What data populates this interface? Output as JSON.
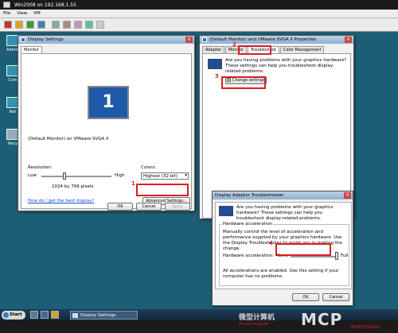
{
  "vm": {
    "title": "Win2008 on 192.168.1.55",
    "menu": [
      "File",
      "View",
      "VM"
    ]
  },
  "desktop": {
    "icons": [
      "Admin",
      "Com",
      "Net",
      "Recy"
    ]
  },
  "display_settings": {
    "title": "Display Settings",
    "tab": "Monitor",
    "monitor_number": "1",
    "monitor_name": "(Default Monitor) on VMware SVGA II",
    "resolution_label": "Resolution:",
    "low": "Low",
    "high": "High",
    "resolution_value": "1024 by 768 pixels",
    "colors_label": "Colors:",
    "colors_value": "Highest (32 bit)",
    "help_link": "How do I get the best display?",
    "advanced_button": "Advanced Settings...",
    "ok": "OK",
    "cancel": "Cancel",
    "apply": "Apply"
  },
  "properties": {
    "title": "(Default Monitor) and VMware SVGA II Properties",
    "tabs": [
      "Adapter",
      "Monitor",
      "Troubleshoot",
      "Color Management"
    ],
    "text": "Are you having problems with your graphics hardware? These settings can help you troubleshoot display-related problems.",
    "change_button": "Change settings"
  },
  "troubleshooter": {
    "title": "Display Adapter Troubleshooter",
    "intro": "Are you having problems with your graphics hardware? These settings can help you troubleshoot display-related problems.",
    "group": "Hardware acceleration",
    "desc": "Manually control the level of acceleration and performance supplied by your graphics hardware. Use the Display Troubleshooter to assist you in making the change.",
    "label": "Hardware acceleration:",
    "none": "None",
    "full": "Full",
    "status": "All accelerations are enabled. Use this setting if your computer has no problems.",
    "ok": "OK",
    "cancel": "Cancel"
  },
  "annotations": [
    "1",
    "2",
    "3",
    "4"
  ],
  "taskbar": {
    "start": "Start",
    "item": "Display Settings"
  },
  "watermark": {
    "cn": "微型计算机",
    "sub": "MicroComputer",
    "logo": "MCP",
    "tag": "PROFESSIONAL"
  },
  "colors": {
    "highlight": "#d81e25",
    "desktop": "#1c5e75"
  }
}
